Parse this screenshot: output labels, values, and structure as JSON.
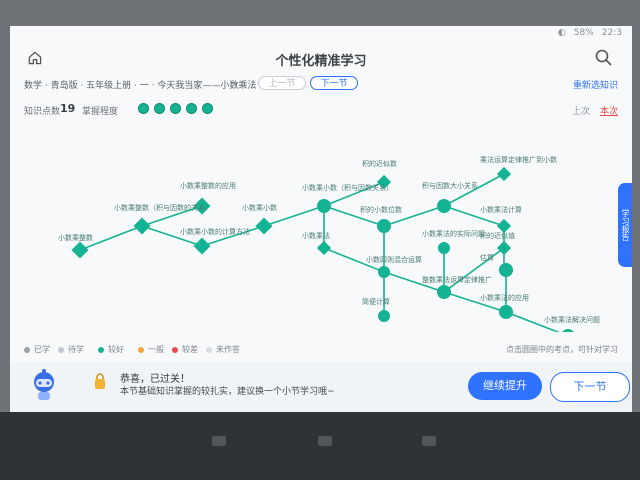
{
  "status": {
    "wifi": "wifi-icon",
    "battery": "58%",
    "time": "22:3"
  },
  "header": {
    "title": "个性化精准学习",
    "home_icon": "home-icon",
    "search_icon": "search-icon"
  },
  "breadcrumb": {
    "text": "数学 · 青岛版 · 五年级上册 · 一 · 今天我当家——小数乘法",
    "prev": "上一节",
    "next": "下一节",
    "reset": "重新选知识"
  },
  "stats": {
    "label": "知识点数",
    "value": "19",
    "mastery_label": "掌握程度",
    "up": "上次",
    "down": "本次"
  },
  "graph": {
    "nodes": [
      {
        "label": "小数乘整数"
      },
      {
        "label": "小数乘整数（积与因数的关系）"
      },
      {
        "label": "小数乘整数的应用"
      },
      {
        "label": "小数乘小数的计算方法"
      },
      {
        "label": "小数乘小数"
      },
      {
        "label": "小数乘小数（积与因数关系）"
      },
      {
        "label": "积的近似数"
      },
      {
        "label": "积的小数位数"
      },
      {
        "label": "小数乘法"
      },
      {
        "label": "积与因数大小关系"
      },
      {
        "label": "乘法运算定律推广到小数"
      },
      {
        "label": "小数乘法计算"
      },
      {
        "label": "小数四则混合运算"
      },
      {
        "label": "小数乘法的实际问题"
      },
      {
        "label": "整数乘法运算定律推广"
      },
      {
        "label": "简便计算"
      },
      {
        "label": "积的近似值"
      },
      {
        "label": "估算"
      },
      {
        "label": "小数乘法的应用"
      },
      {
        "label": "小数乘法解决问题"
      },
      {
        "label": "用小数乘法解决问题"
      }
    ]
  },
  "legend": {
    "items": [
      "已学",
      "待学",
      "较好",
      "一般",
      "较差",
      "未作答"
    ],
    "hint": "点击圆圈中的考点，可针对学习"
  },
  "footer": {
    "msg1": "恭喜，已过关！",
    "msg2": "本节基础知识掌握的较扎实，建议换一个小节学习哦~",
    "continue": "继续提升",
    "next": "下一节"
  },
  "side_tab": {
    "text": "学习报告"
  }
}
